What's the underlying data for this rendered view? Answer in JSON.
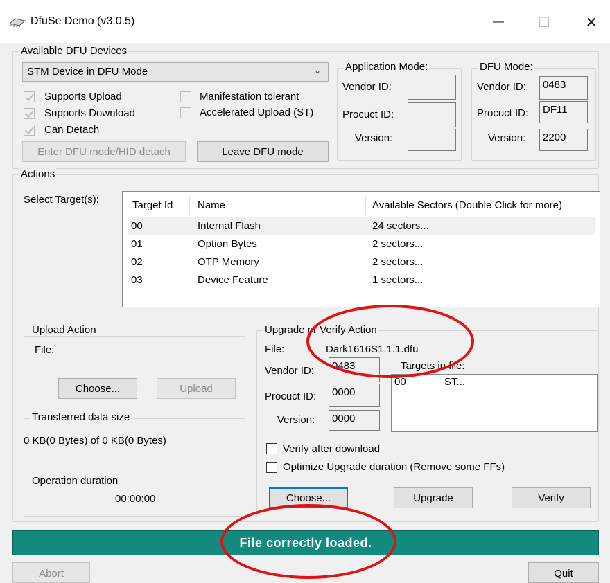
{
  "window": {
    "title": "DfuSe Demo (v3.0.5)",
    "minimize_glyph": "—",
    "maximize_glyph": "☐",
    "close_glyph": "✕"
  },
  "devices": {
    "group_label": "Available DFU Devices",
    "selected_device": "STM Device in DFU Mode",
    "supports_upload": "Supports Upload",
    "supports_download": "Supports Download",
    "can_detach": "Can Detach",
    "manifestation_tolerant": "Manifestation tolerant",
    "accelerated_upload": "Accelerated Upload (ST)",
    "enter_dfu_button": "Enter DFU mode/HID detach",
    "leave_dfu_button": "Leave DFU mode"
  },
  "application_mode": {
    "label": "Application Mode:",
    "vendor_label": "Vendor ID:",
    "product_label": "Procuct ID:",
    "version_label": "Version:",
    "vendor_value": "",
    "product_value": "",
    "version_value": ""
  },
  "dfu_mode": {
    "label": "DFU Mode:",
    "vendor_label": "Vendor ID:",
    "product_label": "Procuct ID:",
    "version_label": "Version:",
    "vendor_value": "0483",
    "product_value": "DF11",
    "version_value": "2200"
  },
  "actions": {
    "group_label": "Actions",
    "select_targets_label": "Select Target(s):",
    "columns": [
      "Target Id",
      "Name",
      "Available Sectors (Double Click for more)"
    ],
    "rows": [
      {
        "id": "00",
        "name": "Internal Flash",
        "sectors": "24 sectors..."
      },
      {
        "id": "01",
        "name": "Option Bytes",
        "sectors": "2 sectors..."
      },
      {
        "id": "02",
        "name": "OTP Memory",
        "sectors": "2 sectors..."
      },
      {
        "id": "03",
        "name": "Device Feature",
        "sectors": "1 sectors..."
      }
    ]
  },
  "upload_action": {
    "group_label": "Upload Action",
    "file_label": "File:",
    "choose_button": "Choose...",
    "upload_button": "Upload"
  },
  "transferred": {
    "group_label": "Transferred data size",
    "value": "0 KB(0 Bytes) of 0 KB(0 Bytes)"
  },
  "operation": {
    "group_label": "Operation duration",
    "value": "00:00:00"
  },
  "upgrade_action": {
    "group_label": "Upgrade or Verify Action",
    "file_label": "File:",
    "file_value": "Dark1616S1.1.1.dfu",
    "vendor_label": "Vendor ID:",
    "vendor_value": "0483",
    "product_label": "Procuct ID:",
    "product_value": "0000",
    "version_label": "Version:",
    "version_value": "0000",
    "targets_in_file_label": "Targets in file:",
    "targets_in_file": [
      {
        "id": "00",
        "name": "ST..."
      }
    ],
    "verify_after_download": "Verify after download",
    "optimize_upgrade": "Optimize Upgrade duration (Remove some FFs)",
    "choose_button": "Choose...",
    "upgrade_button": "Upgrade",
    "verify_button": "Verify"
  },
  "status": {
    "text": "File correctly loaded.",
    "background_color": "#138a7e"
  },
  "bottom": {
    "abort_button": "Abort",
    "quit_button": "Quit"
  },
  "colors": {
    "annotation_circle": "#e11212"
  }
}
